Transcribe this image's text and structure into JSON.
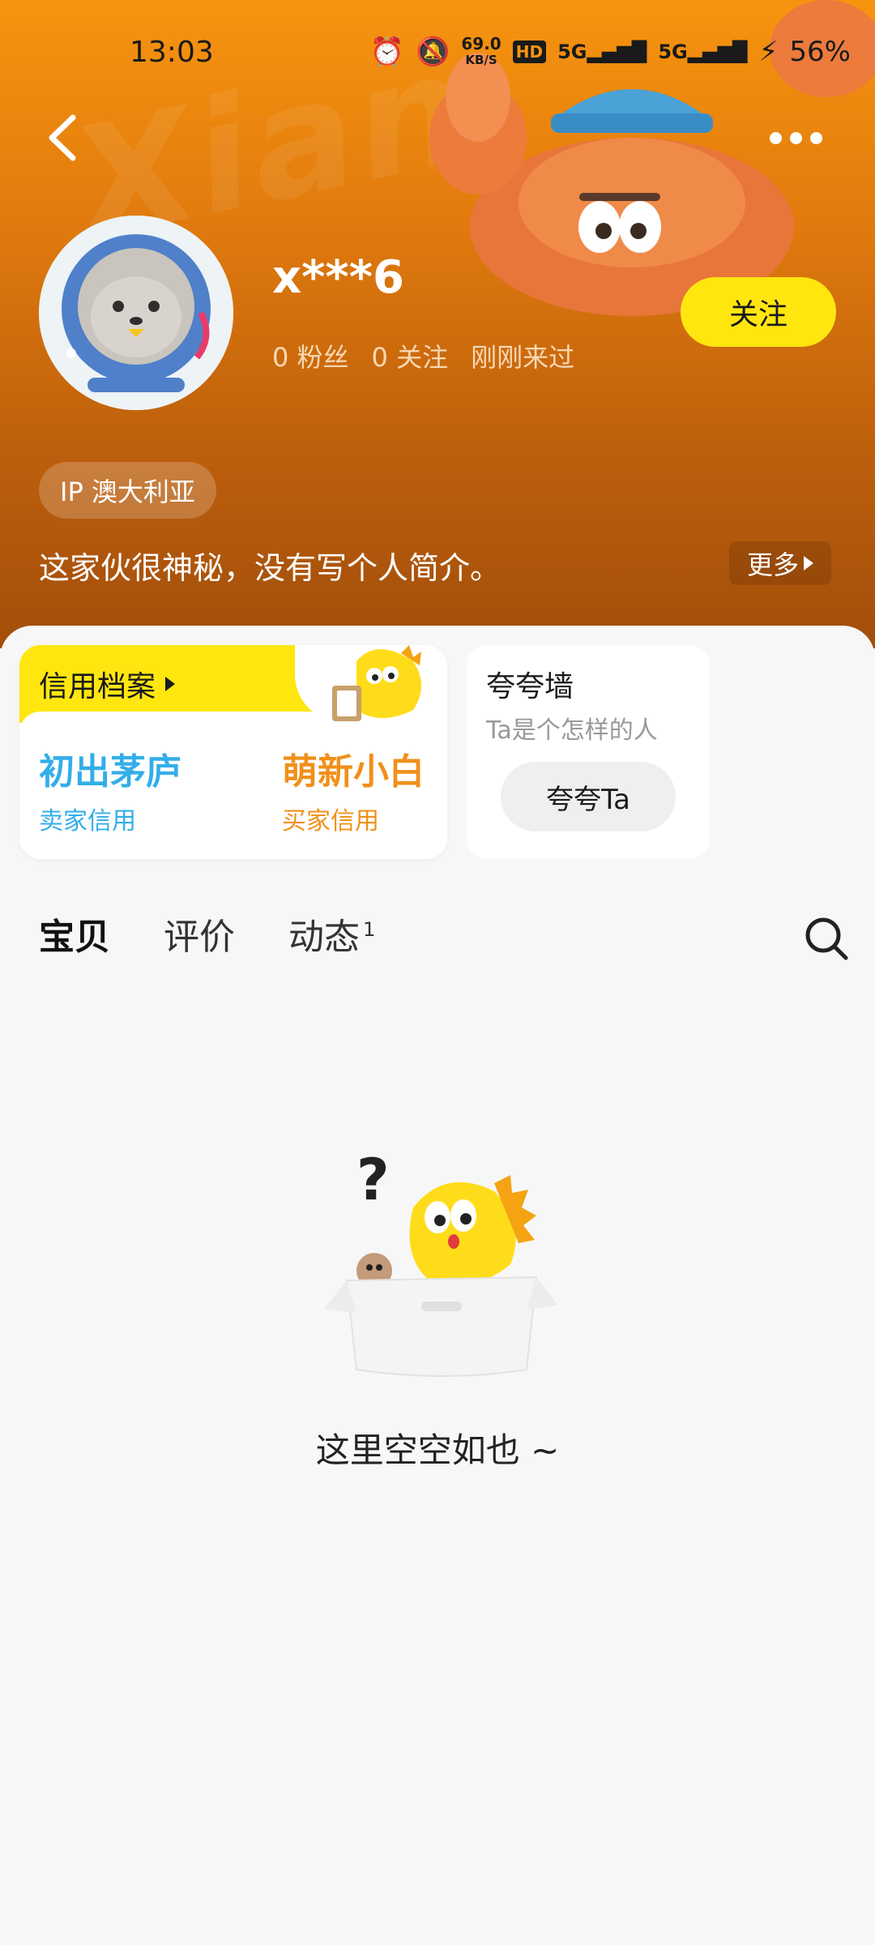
{
  "status_bar": {
    "time": "13:03",
    "net_speed": "69.0",
    "net_speed_unit": "KB/S",
    "hd_badge": "HD",
    "signal_1": "5G",
    "signal_2": "5G",
    "battery": "56%"
  },
  "header": {
    "watermark": "Xian",
    "username": "x***6",
    "stats": {
      "fans": "0 粉丝",
      "following": "0 关注",
      "last_seen": "刚刚来过"
    },
    "follow_label": "关注",
    "ip_label": "IP 澳大利亚",
    "bio": "这家伙很神秘，没有写个人简介。",
    "more_label": "更多"
  },
  "credit": {
    "title": "信用档案",
    "seller": {
      "value": "初出茅庐",
      "label": "卖家信用",
      "color": "#33aee9"
    },
    "buyer": {
      "value": "萌新小白",
      "label": "买家信用",
      "color": "#f0901a"
    }
  },
  "praise": {
    "title": "夸夸墙",
    "subtitle": "Ta是个怎样的人",
    "button_label": "夸夸Ta"
  },
  "tabs": [
    {
      "label": "宝贝",
      "active": true
    },
    {
      "label": "评价",
      "active": false
    },
    {
      "label": "动态",
      "active": false,
      "badge": "1"
    }
  ],
  "empty_state": {
    "question_mark": "?",
    "message": "这里空空如也 ~"
  },
  "colors": {
    "accent_yellow": "#ffe60f",
    "header_orange": "#f7940f"
  }
}
